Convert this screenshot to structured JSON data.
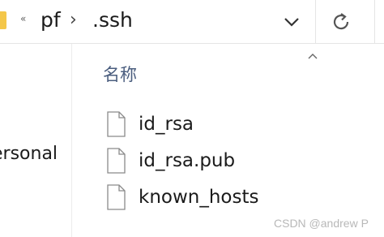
{
  "address_bar": {
    "overflow_label": "«",
    "breadcrumbs": [
      {
        "label": "pf"
      },
      {
        "label": ".ssh"
      }
    ],
    "separator": "›"
  },
  "navigation": {
    "items": [
      {
        "label": "ersonal"
      }
    ]
  },
  "file_list": {
    "column_header": "名称",
    "sort_direction": "ascending",
    "files": [
      {
        "name": "id_rsa",
        "icon": "file-icon"
      },
      {
        "name": "id_rsa.pub",
        "icon": "file-icon"
      },
      {
        "name": "known_hosts",
        "icon": "file-icon"
      }
    ]
  },
  "watermark": "CSDN @andrew P",
  "colors": {
    "header_text": "#4a5d7e",
    "folder": "#f4c74a",
    "divider": "#e5e5e5"
  }
}
